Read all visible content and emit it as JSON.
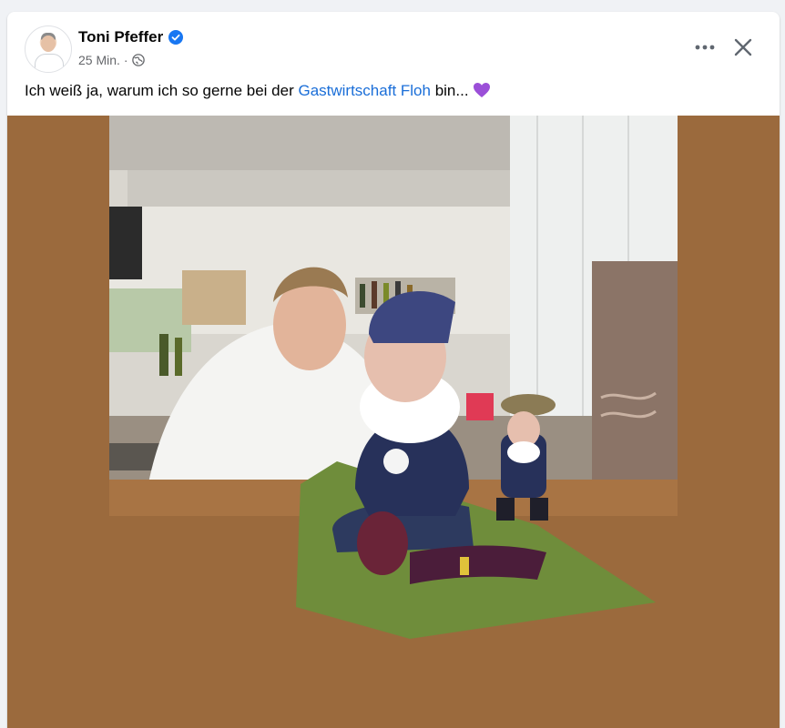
{
  "post": {
    "author_name": "Toni Pfeffer",
    "timestamp": "25 Min.",
    "separator": "·",
    "text_before": "Ich weiß ja, warum ich so gerne bei der ",
    "link_text": "Gastwirtschaft Floh",
    "text_after": " bin...",
    "emoji": "purple-heart"
  },
  "icons": {
    "verified": "verified-badge-icon",
    "audience": "globe-icon",
    "more": "more-options-icon",
    "close": "close-icon"
  },
  "colors": {
    "link": "#1a6ed8",
    "verified": "#1877f2",
    "photo_side_background": "#9b6a3d",
    "heart": "#9b4fd8"
  }
}
